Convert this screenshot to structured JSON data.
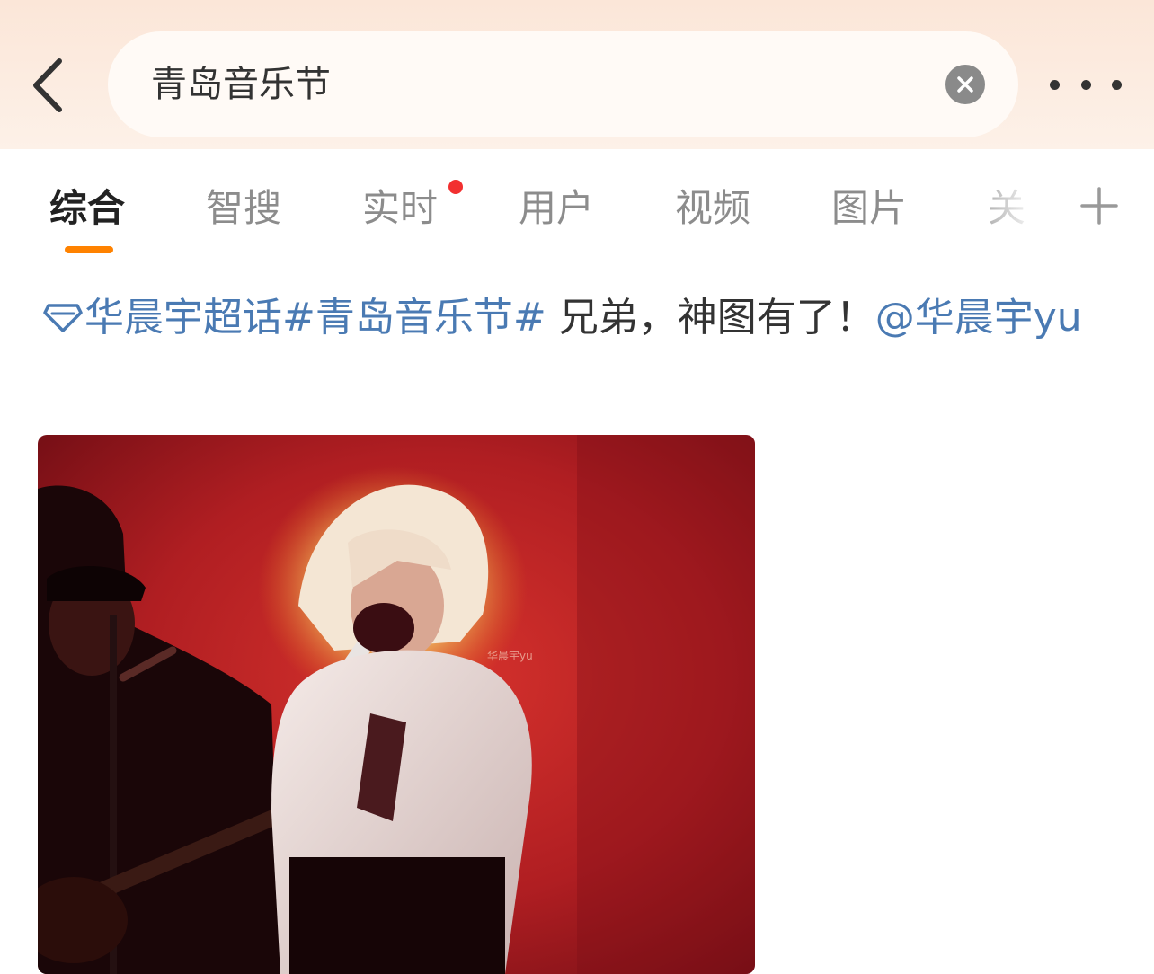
{
  "header": {
    "back_icon": "chevron-left-icon",
    "search_value": "青岛音乐节",
    "clear_icon": "close-circle-icon",
    "more_icon": "more-dots-icon"
  },
  "tabs": [
    {
      "label": "综合",
      "active": true
    },
    {
      "label": "智搜"
    },
    {
      "label": "实时",
      "has_dot": true
    },
    {
      "label": "用户"
    },
    {
      "label": "视频"
    },
    {
      "label": "图片"
    },
    {
      "label": "关"
    }
  ],
  "tab_add_icon": "plus-icon",
  "post": {
    "supertopic_icon": "diamond-icon",
    "supertopic": "华晨宇超话",
    "hashtag": "#青岛音乐节#",
    "text": " 兄弟，神图有了！",
    "mention": "@华晨宇yu",
    "image_watermark": "华晨宇yu"
  },
  "colors": {
    "accent": "#ff8200",
    "link": "#4a7ab3",
    "notify_dot": "#f23030",
    "header_bg": "#fbe6d8"
  }
}
